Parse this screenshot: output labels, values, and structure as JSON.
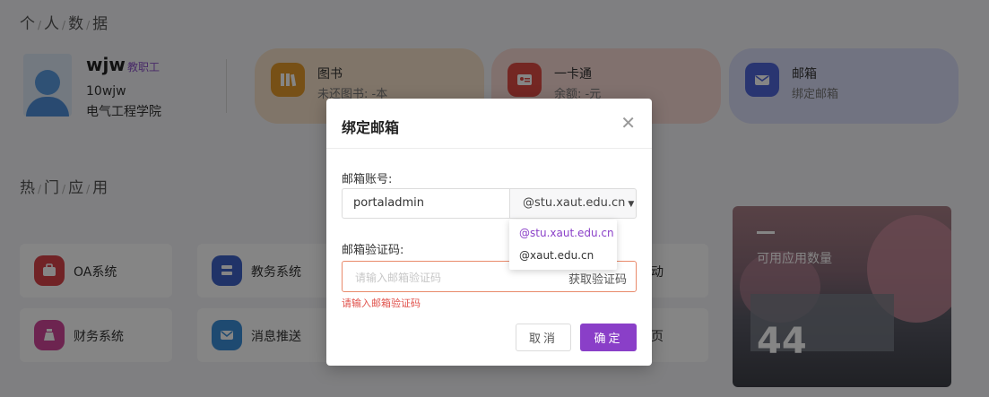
{
  "personal": {
    "section_title": [
      "个",
      "人",
      "数",
      "据"
    ],
    "name": "wjw",
    "role": "教职工",
    "user_id": "10wjw",
    "department": "电气工程学院"
  },
  "cards": {
    "library": {
      "title": "图书",
      "subtitle": "未还图书: -本",
      "bg": "#f6e1c9",
      "icon_bg": "#e49a2b"
    },
    "card": {
      "title": "一卡通",
      "subtitle": "余额: -元",
      "bg": "#f8d9d4",
      "icon_bg": "#df4b43"
    },
    "mail": {
      "title": "邮箱",
      "subtitle": "绑定邮箱",
      "bg": "#d8dcf7",
      "icon_bg": "#4f66d9"
    }
  },
  "hot_apps": {
    "section_title": [
      "热",
      "门",
      "应",
      "用"
    ],
    "items": [
      {
        "label": "OA系统",
        "icon": "briefcase-icon",
        "color": "#d9434a"
      },
      {
        "label": "教务系统",
        "icon": "list-icon",
        "color": "#3f63c8"
      },
      {
        "label": "财务系统",
        "icon": "money-bag-icon",
        "color": "#d1459a"
      },
      {
        "label": "消息推送",
        "icon": "message-icon",
        "color": "#3a8fd8"
      }
    ],
    "partial_labels": [
      "动",
      "页"
    ]
  },
  "stats_card": {
    "label": "可用应用数量",
    "count": "44"
  },
  "modal": {
    "title": "绑定邮箱",
    "email_label": "邮箱账号:",
    "email_value": "portaladmin",
    "domain_selected": "@stu.xaut.edu.cn",
    "domain_options": [
      "@stu.xaut.edu.cn",
      "@xaut.edu.cn"
    ],
    "code_label": "邮箱验证码:",
    "code_placeholder": "请输入邮箱验证码",
    "get_code_label": "获取验证码",
    "error_message": "请输入邮箱验证码",
    "cancel_label": "取消",
    "confirm_label": "确定"
  }
}
